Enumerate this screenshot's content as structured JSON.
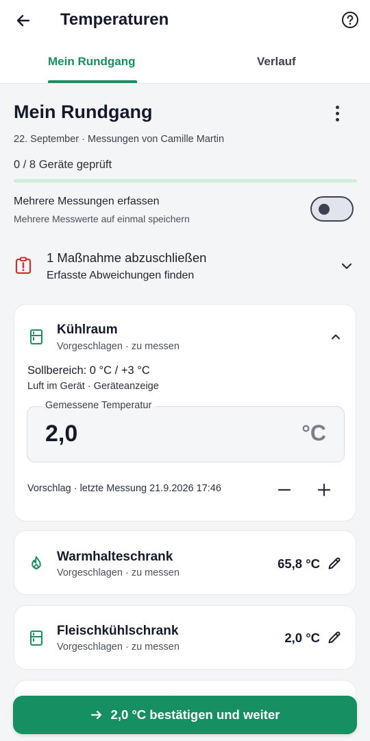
{
  "header": {
    "title": "Temperaturen",
    "back_icon": "arrow-left-icon",
    "help_icon": "help-circle-icon"
  },
  "tabs": [
    {
      "label": "Mein Rundgang",
      "active": true
    },
    {
      "label": "Verlauf",
      "active": false
    }
  ],
  "round": {
    "title": "Mein Rundgang",
    "meta": "22. September · Messungen von Camille Martin",
    "progress_text": "0 / 8 Geräte geprüft",
    "progress_fraction": 0
  },
  "multi": {
    "title": "Mehrere Messungen erfassen",
    "subtitle": "Mehrere Messwerte auf einmal speichern",
    "enabled": false
  },
  "alert": {
    "title": "1 Maßnahme abzuschließen",
    "subtitle": "Erfasste Abweichungen finden",
    "icon": "clipboard-alert-icon"
  },
  "active_device": {
    "name": "Kühlraum",
    "status": "Vorgeschlagen · zu messen",
    "icon": "fridge-icon",
    "target_range": "Sollbereich: 0 °C / +3 °C",
    "target_desc": "Luft im Gerät · Geräteanzeige",
    "field_label": "Gemessene Temperatur",
    "field_value": "2,0",
    "field_unit": "°C",
    "suggestion": "Vorschlag · letzte Messung 21.9.2026 17:46"
  },
  "devices": [
    {
      "name": "Warmhalteschrank",
      "status": "Vorgeschlagen · zu messen",
      "value": "65,8 °C",
      "icon": "flame-icon"
    },
    {
      "name": "Fleischkühlschrank",
      "status": "Vorgeschlagen · zu messen",
      "value": "2,0 °C",
      "icon": "fridge-icon"
    }
  ],
  "confirm_button": {
    "label": "2,0 °C bestätigen und weiter",
    "icon": "arrow-right-icon"
  },
  "colors": {
    "accent": "#169063",
    "alert": "#d32f2f",
    "progress_track": "#cfeedd"
  }
}
